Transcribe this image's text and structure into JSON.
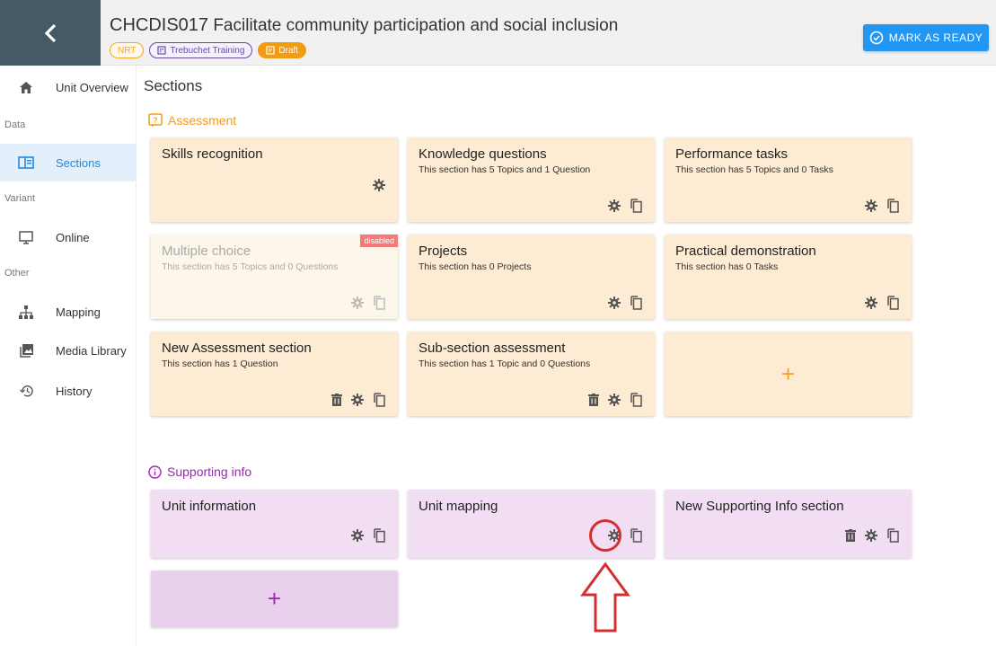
{
  "header": {
    "unit_code": "CHCDIS017",
    "unit_title": "Facilitate community participation and social inclusion",
    "tags": {
      "nrt": "NRT",
      "org": "Trebuchet Training",
      "status": "Draft"
    },
    "ready_button": "MARK AS READY",
    "accent": "#2196f3"
  },
  "sidebar": {
    "unit_overview": "Unit Overview",
    "group_data": "Data",
    "sections": "Sections",
    "group_variant": "Variant",
    "online": "Online",
    "group_other": "Other",
    "mapping": "Mapping",
    "media_library": "Media Library",
    "history": "History"
  },
  "main": {
    "title": "Sections",
    "assessment_label": "Assessment",
    "supporting_label": "Supporting info",
    "assessment_cards": [
      {
        "title": "Skills recognition",
        "subtitle": ""
      },
      {
        "title": "Knowledge questions",
        "subtitle": "This section has 5 Topics and 1 Question"
      },
      {
        "title": "Performance tasks",
        "subtitle": "This section has 5 Topics and 0 Tasks"
      },
      {
        "title": "Multiple choice",
        "subtitle": "This section has 5 Topics and 0 Questions",
        "badge": "disabled"
      },
      {
        "title": "Projects",
        "subtitle": "This section has 0 Projects"
      },
      {
        "title": "Practical demonstration",
        "subtitle": "This section has 0 Tasks"
      },
      {
        "title": "New Assessment section",
        "subtitle": "This section has 1 Question"
      },
      {
        "title": "Sub-section assessment",
        "subtitle": "This section has 1 Topic and 0 Questions"
      }
    ],
    "support_cards": [
      {
        "title": "Unit information"
      },
      {
        "title": "Unit mapping"
      },
      {
        "title": "New Supporting Info section"
      }
    ],
    "add_symbol": "+"
  }
}
